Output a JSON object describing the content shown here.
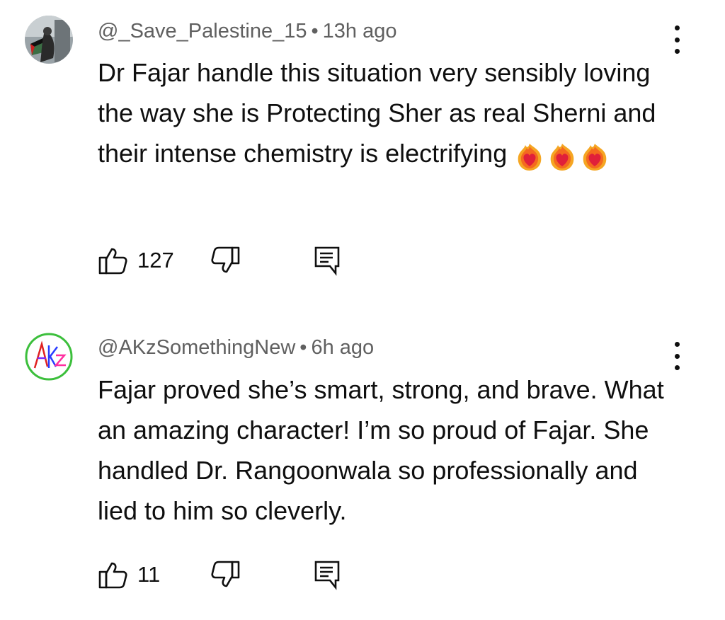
{
  "comments": [
    {
      "author": "@_Save_Palestine_15",
      "separator": "•",
      "time": "13h ago",
      "text": "Dr Fajar handle this situation very sensibly loving the way she is Protecting Sher as real Sherni and their intense chemistry is electrifying",
      "emoji": "heart-on-fire",
      "emoji_count": 3,
      "likes": "127",
      "avatar_icon": "flag-avatar-icon"
    },
    {
      "author": "@AKzSomethingNew",
      "separator": "•",
      "time": "6h ago",
      "text": "Fajar proved she’s smart, strong, and brave. What an amazing character! I’m so proud of Fajar. She handled Dr. Rangoonwala so professionally and lied to him so cleverly.",
      "likes": "11",
      "avatar_icon": "akz-logo-avatar-icon"
    }
  ],
  "icons": {
    "like": "thumb-up-icon",
    "dislike": "thumb-down-icon",
    "reply": "reply-icon",
    "menu": "more-vertical-icon"
  },
  "colors": {
    "text": "#0f0f0f",
    "meta": "#606060",
    "background": "#ffffff"
  }
}
